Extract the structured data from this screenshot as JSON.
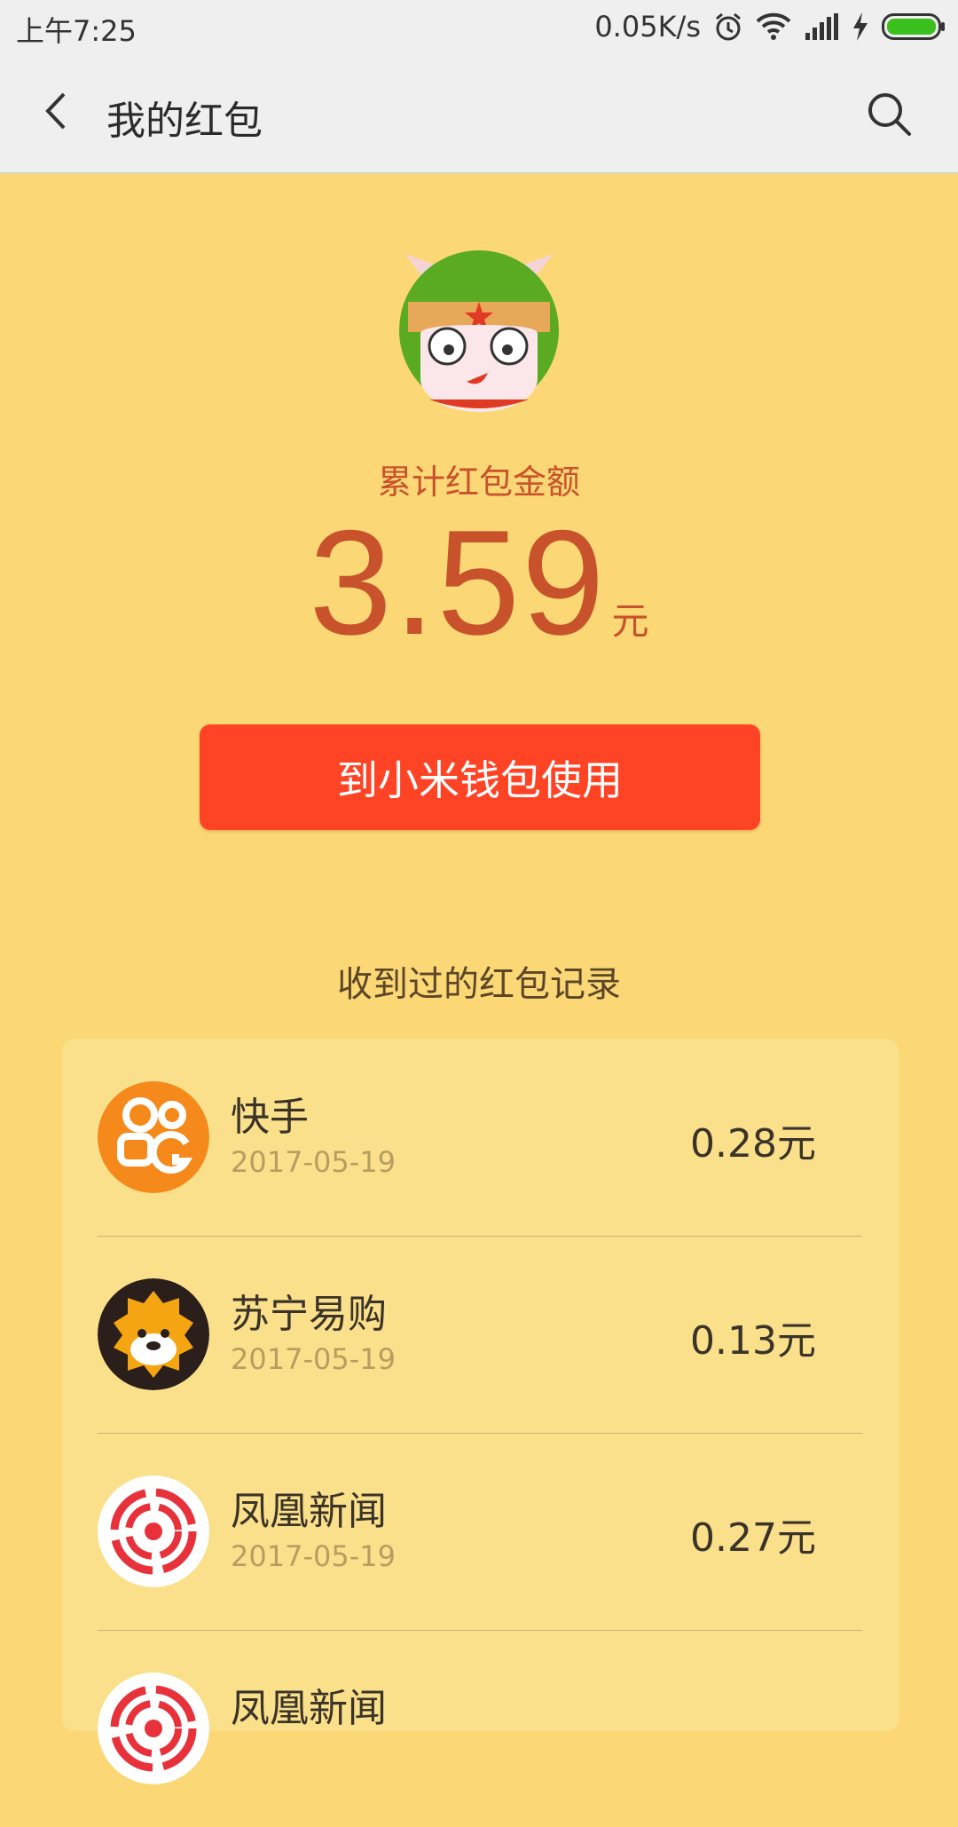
{
  "status_bar": {
    "time": "上午7:25",
    "speed": "0.05K/s",
    "icons": [
      "alarm-icon",
      "wifi-icon",
      "signal-icon",
      "charging-icon",
      "battery-icon"
    ]
  },
  "header": {
    "title": "我的红包",
    "back_icon": "chevron-left-icon",
    "search_icon": "search-icon"
  },
  "summary": {
    "avatar": "mitu-bunny-avatar",
    "total_label": "累计红包金额",
    "amount": "3.59",
    "unit": "元",
    "wallet_button": "到小米钱包使用"
  },
  "records": {
    "title": "收到过的红包记录",
    "items": [
      {
        "name": "快手",
        "date": "2017-05-19",
        "amount": "0.28元",
        "logo": "kuaishou-logo"
      },
      {
        "name": "苏宁易购",
        "date": "2017-05-19",
        "amount": "0.13元",
        "logo": "suning-logo"
      },
      {
        "name": "凤凰新闻",
        "date": "2017-05-19",
        "amount": "0.27元",
        "logo": "ifeng-logo"
      },
      {
        "name": "凤凰新闻",
        "date": "",
        "amount": "",
        "logo": "ifeng-logo"
      }
    ]
  },
  "colors": {
    "background": "#fbd875",
    "card": "#fbe08b",
    "accent_red": "#ff4426",
    "amount_text": "#c8522b"
  }
}
